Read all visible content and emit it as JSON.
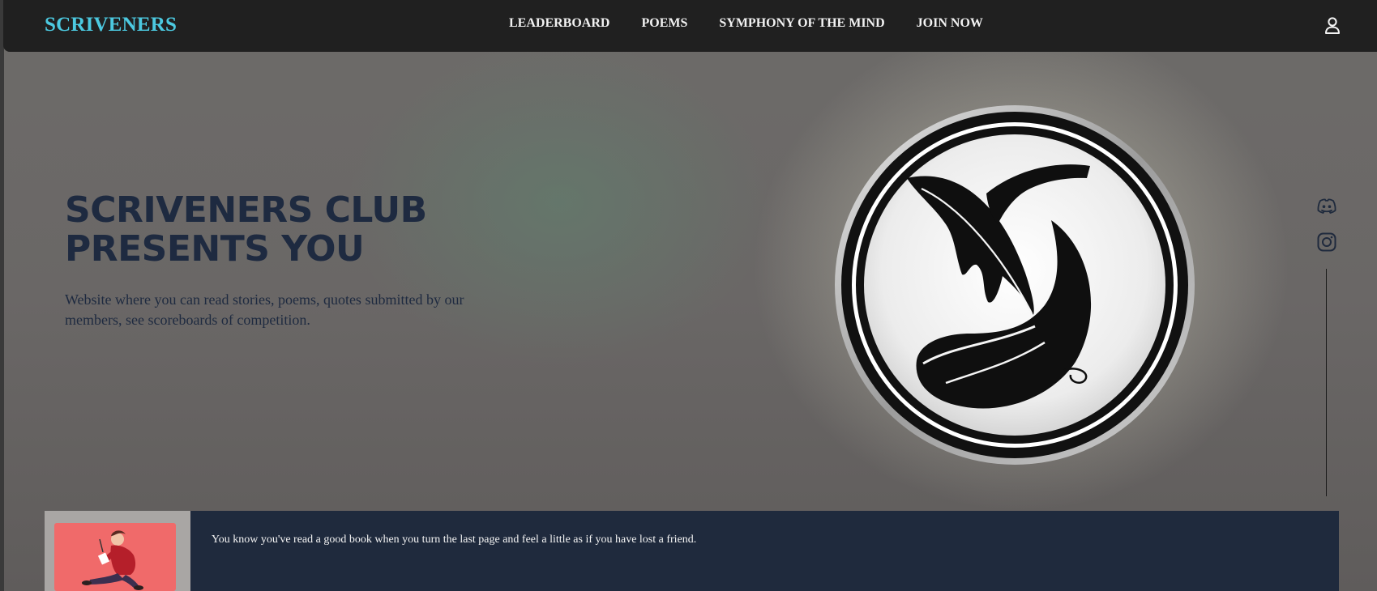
{
  "header": {
    "brand": "SCRIVENERS",
    "nav": [
      {
        "label": "LEADERBOARD"
      },
      {
        "label": "POEMS"
      },
      {
        "label": "SYMPHONY OF THE MIND"
      },
      {
        "label": "JOIN NOW"
      }
    ],
    "account_icon": "user-icon"
  },
  "hero": {
    "title_line1": "SCRIVENERS CLUB",
    "title_line2": "PRESENTS YOU",
    "description": "Website where you can read stories, poems, quotes submitted by our members, see scoreboards of competition.",
    "logo_icon": "quill-feather-logo"
  },
  "social": {
    "icons": [
      "discord-icon",
      "instagram-icon"
    ]
  },
  "quote": {
    "text": "You know you've read a good book when you turn the last page and feel a little as if you have lost a friend.",
    "image_icon": "reading-person-illustration"
  },
  "colors": {
    "brand": "#4cc9e0",
    "header_bg": "#202020",
    "hero_text": "#1e2a40",
    "quote_bg": "#1f2a3d",
    "thumb_bg": "#f06a6a"
  }
}
